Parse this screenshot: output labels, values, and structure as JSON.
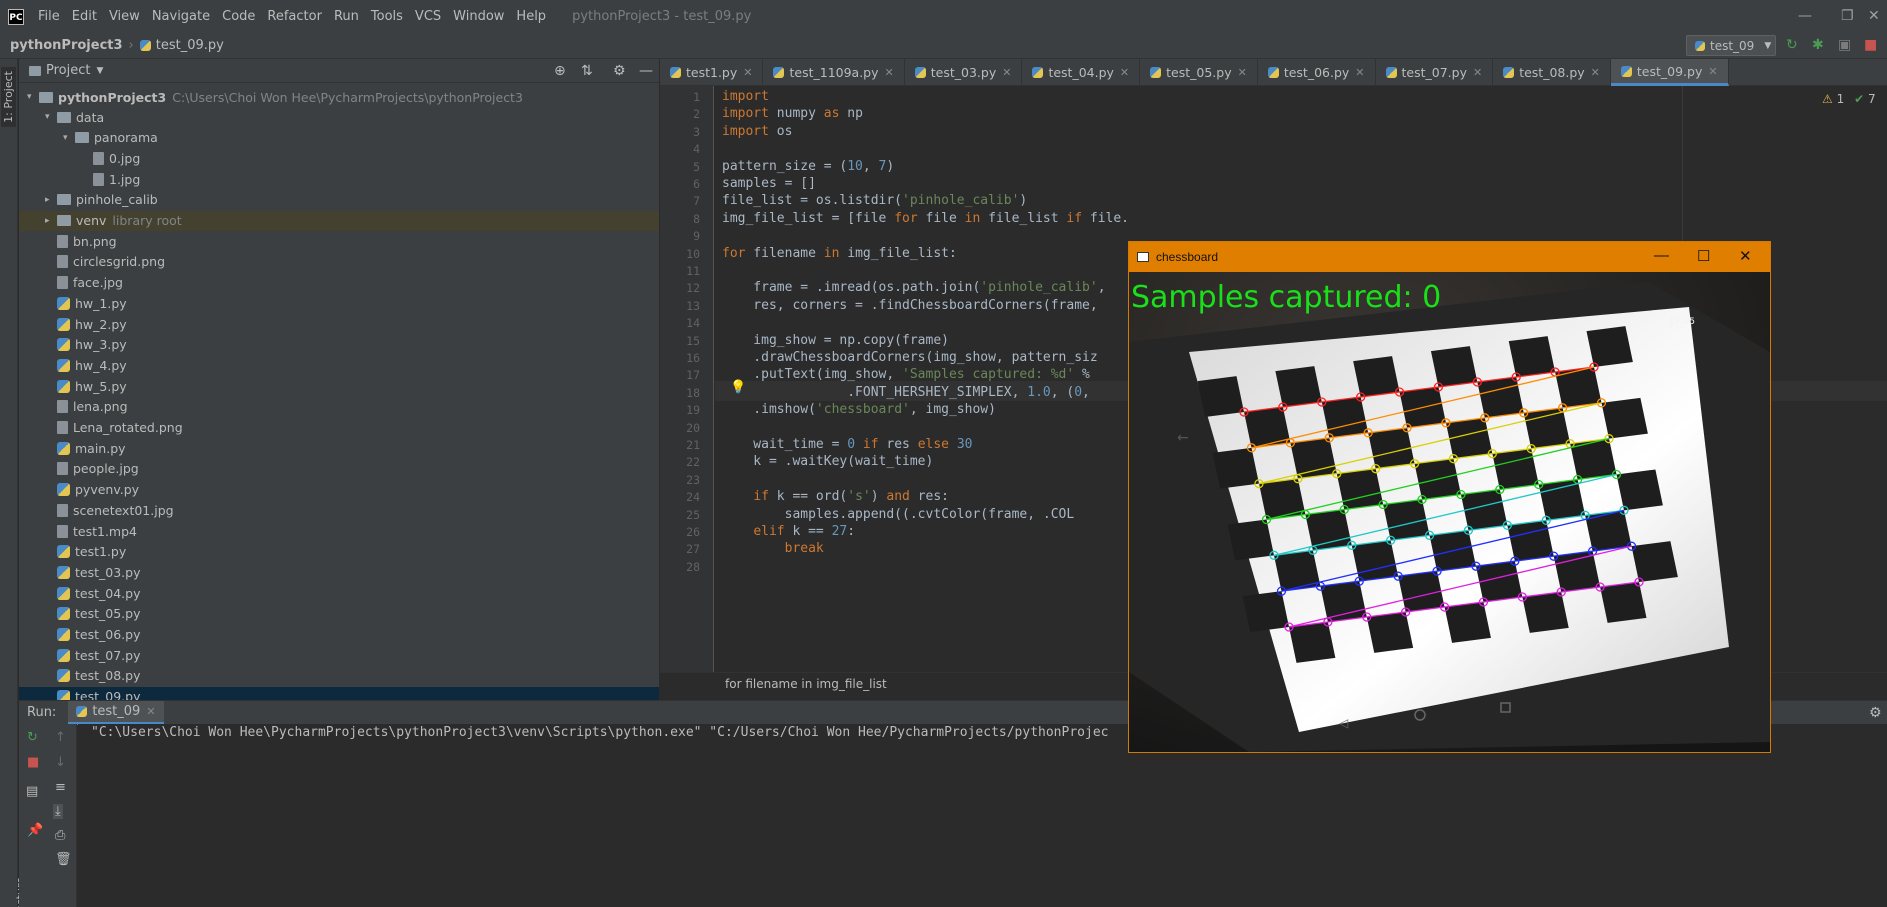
{
  "app": {
    "window_title": "pythonProject3 - test_09.py",
    "menu": [
      "File",
      "Edit",
      "View",
      "Navigate",
      "Code",
      "Refactor",
      "Run",
      "Tools",
      "VCS",
      "Window",
      "Help"
    ]
  },
  "nav": {
    "project": "pythonProject3",
    "file": "test_09.py",
    "run_config": "test_09"
  },
  "left_strip": {
    "project_tab": "1: Project",
    "structure_tab": "Z: Structure"
  },
  "project_pane": {
    "title": "Project",
    "root_name": "pythonProject3",
    "root_path": "C:\\Users\\Choi Won Hee\\PycharmProjects\\pythonProject3",
    "rows": [
      {
        "label": "data",
        "kind": "folder",
        "depth": 1,
        "arrow": "▾"
      },
      {
        "label": "panorama",
        "kind": "folder",
        "depth": 2,
        "arrow": "▾"
      },
      {
        "label": "0.jpg",
        "kind": "file",
        "depth": 3,
        "arrow": ""
      },
      {
        "label": "1.jpg",
        "kind": "file",
        "depth": 3,
        "arrow": ""
      },
      {
        "label": "pinhole_calib",
        "kind": "folder",
        "depth": 1,
        "arrow": "▸"
      },
      {
        "label": "venv",
        "kind": "folder",
        "depth": 1,
        "arrow": "▸",
        "note": "library root"
      },
      {
        "label": "bn.png",
        "kind": "file",
        "depth": 1,
        "arrow": ""
      },
      {
        "label": "circlesgrid.png",
        "kind": "file",
        "depth": 1,
        "arrow": ""
      },
      {
        "label": "face.jpg",
        "kind": "file",
        "depth": 1,
        "arrow": ""
      },
      {
        "label": "hw_1.py",
        "kind": "py",
        "depth": 1,
        "arrow": ""
      },
      {
        "label": "hw_2.py",
        "kind": "py",
        "depth": 1,
        "arrow": ""
      },
      {
        "label": "hw_3.py",
        "kind": "py",
        "depth": 1,
        "arrow": ""
      },
      {
        "label": "hw_4.py",
        "kind": "py",
        "depth": 1,
        "arrow": ""
      },
      {
        "label": "hw_5.py",
        "kind": "py",
        "depth": 1,
        "arrow": ""
      },
      {
        "label": "lena.png",
        "kind": "file",
        "depth": 1,
        "arrow": ""
      },
      {
        "label": "Lena_rotated.png",
        "kind": "file",
        "depth": 1,
        "arrow": ""
      },
      {
        "label": "main.py",
        "kind": "py",
        "depth": 1,
        "arrow": ""
      },
      {
        "label": "people.jpg",
        "kind": "file",
        "depth": 1,
        "arrow": ""
      },
      {
        "label": "pyvenv.py",
        "kind": "py",
        "depth": 1,
        "arrow": ""
      },
      {
        "label": "scenetext01.jpg",
        "kind": "file",
        "depth": 1,
        "arrow": ""
      },
      {
        "label": "test1.mp4",
        "kind": "file",
        "depth": 1,
        "arrow": ""
      },
      {
        "label": "test1.py",
        "kind": "py",
        "depth": 1,
        "arrow": ""
      },
      {
        "label": "test_03.py",
        "kind": "py",
        "depth": 1,
        "arrow": ""
      },
      {
        "label": "test_04.py",
        "kind": "py",
        "depth": 1,
        "arrow": ""
      },
      {
        "label": "test_05.py",
        "kind": "py",
        "depth": 1,
        "arrow": ""
      },
      {
        "label": "test_06.py",
        "kind": "py",
        "depth": 1,
        "arrow": ""
      },
      {
        "label": "test_07.py",
        "kind": "py",
        "depth": 1,
        "arrow": ""
      },
      {
        "label": "test_08.py",
        "kind": "py",
        "depth": 1,
        "arrow": ""
      },
      {
        "label": "test_09.py",
        "kind": "py",
        "depth": 1,
        "arrow": "",
        "selected": true
      }
    ]
  },
  "tabs": [
    "test1.py",
    "test_1109a.py",
    "test_03.py",
    "test_04.py",
    "test_05.py",
    "test_06.py",
    "test_07.py",
    "test_08.py",
    "test_09.py"
  ],
  "active_tab": "test_09.py",
  "inspections": {
    "warnings": "1",
    "ok": "7"
  },
  "code_lines": [
    "import cv2",
    "import numpy as np",
    "import os",
    "",
    "pattern_size = (10, 7)",
    "samples = []",
    "file_list = os.listdir('pinhole_calib')",
    "img_file_list = [file for file in file_list if file.",
    "",
    "for filename in img_file_list:",
    "",
    "    frame = cv2.imread(os.path.join('pinhole_calib',",
    "    res, corners = cv2.findChessboardCorners(frame,",
    "",
    "    img_show = np.copy(frame)",
    "    cv2.drawChessboardCorners(img_show, pattern_siz",
    "    cv2.putText(img_show, 'Samples captured: %d' %",
    "                cv2.FONT_HERSHEY_SIMPLEX, 1.0, (0,",
    "    cv2.imshow('chessboard', img_show)",
    "",
    "    wait_time = 0 if res else 30",
    "    k = cv2.waitKey(wait_time)",
    "",
    "    if k == ord('s') and res:",
    "        samples.append((cv2.cvtColor(frame, cv2.COL",
    "    elif k == 27:",
    "        break",
    ""
  ],
  "code_breadcrumb": "for filename in img_file_list",
  "run": {
    "label": "Run:",
    "tab": "test_09",
    "console": "\"C:\\Users\\Choi Won Hee\\PycharmProjects\\pythonProject3\\venv\\Scripts\\python.exe\" \"C:/Users/Choi Won Hee/PycharmProjects/pythonProjec"
  },
  "cv_window": {
    "title": "chessboard",
    "overlay_text": "Samples captured: 0",
    "phone_clock": "17:05",
    "overlay_color": "#19e019"
  }
}
